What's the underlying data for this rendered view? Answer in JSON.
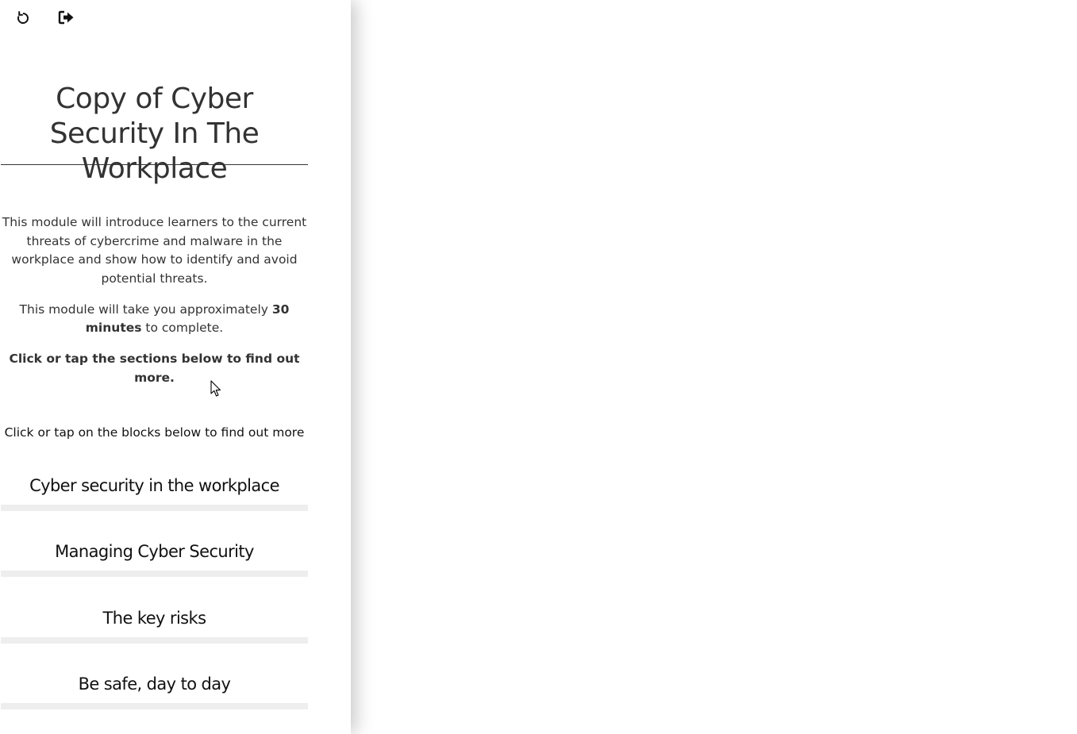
{
  "toolbar": {
    "restart_icon": "restart-icon",
    "exit_icon": "exit-icon"
  },
  "course": {
    "title": "Copy of Cyber Security In The Workplace",
    "intro_paragraph": "This module will introduce learners to the current threats of cybercrime and malware in the workplace and show how to identify and avoid potential threats.",
    "duration_prefix": "This module will take you approximately ",
    "duration_value": "30 minutes",
    "duration_suffix": " to complete.",
    "sections_cta": "Click or tap the sections below to find out more."
  },
  "blocks": {
    "hint": "Click or tap on the blocks below to find out more",
    "items": [
      {
        "label": "Cyber security in the workplace"
      },
      {
        "label": "Managing Cyber Security"
      },
      {
        "label": "The key risks"
      },
      {
        "label": "Be safe, day to day"
      }
    ]
  },
  "colors": {
    "text": "#333333",
    "block_bar": "#eeeeee",
    "background": "#ffffff"
  }
}
